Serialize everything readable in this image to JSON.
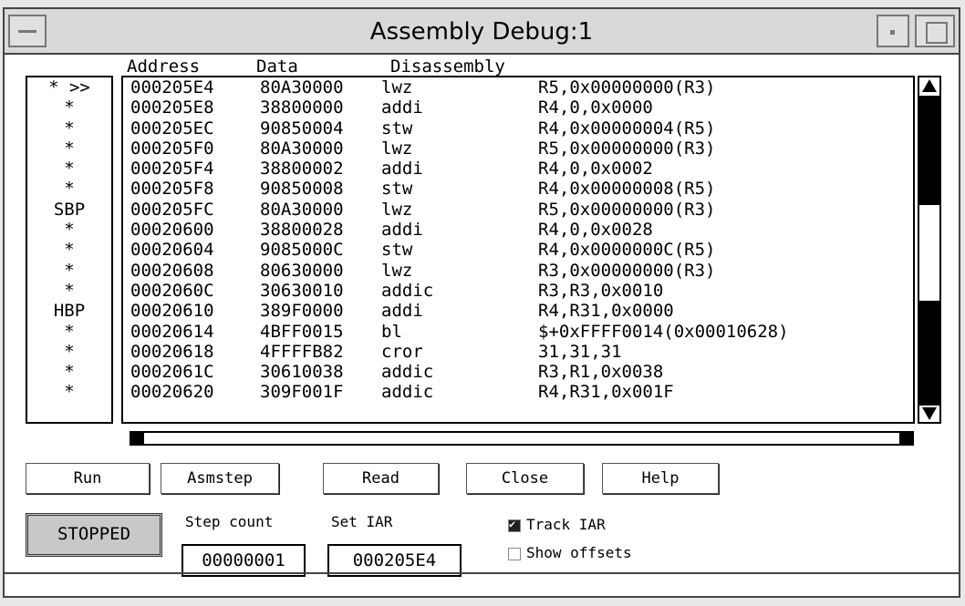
{
  "window": {
    "title": "Assembly Debug:1"
  },
  "headers": {
    "address": "Address",
    "data": "Data",
    "disassembly": "Disassembly"
  },
  "breakpoints": [
    "* >>",
    "*",
    "*",
    "*",
    "*",
    "*",
    "SBP",
    "*",
    "*",
    "*",
    "*",
    "HBP",
    "*",
    "*",
    "*",
    "*"
  ],
  "rows": [
    {
      "addr": "000205E4",
      "data": "80A30000",
      "mnemonic": "lwz",
      "operands": "R5,0x00000000(R3)"
    },
    {
      "addr": "000205E8",
      "data": "38800000",
      "mnemonic": "addi",
      "operands": "R4,0,0x0000"
    },
    {
      "addr": "000205EC",
      "data": "90850004",
      "mnemonic": "stw",
      "operands": "R4,0x00000004(R5)"
    },
    {
      "addr": "000205F0",
      "data": "80A30000",
      "mnemonic": "lwz",
      "operands": "R5,0x00000000(R3)"
    },
    {
      "addr": "000205F4",
      "data": "38800002",
      "mnemonic": "addi",
      "operands": "R4,0,0x0002"
    },
    {
      "addr": "000205F8",
      "data": "90850008",
      "mnemonic": "stw",
      "operands": "R4,0x00000008(R5)"
    },
    {
      "addr": "000205FC",
      "data": "80A30000",
      "mnemonic": "lwz",
      "operands": "R5,0x00000000(R3)"
    },
    {
      "addr": "00020600",
      "data": "38800028",
      "mnemonic": "addi",
      "operands": "R4,0,0x0028"
    },
    {
      "addr": "00020604",
      "data": "9085000C",
      "mnemonic": "stw",
      "operands": "R4,0x0000000C(R5)"
    },
    {
      "addr": "00020608",
      "data": "80630000",
      "mnemonic": "lwz",
      "operands": "R3,0x00000000(R3)"
    },
    {
      "addr": "0002060C",
      "data": "30630010",
      "mnemonic": "addic",
      "operands": "R3,R3,0x0010"
    },
    {
      "addr": "00020610",
      "data": "389F0000",
      "mnemonic": "addi",
      "operands": "R4,R31,0x0000"
    },
    {
      "addr": "00020614",
      "data": "4BFF0015",
      "mnemonic": "bl",
      "operands": "$+0xFFFF0014(0x00010628)"
    },
    {
      "addr": "00020618",
      "data": "4FFFFB82",
      "mnemonic": "cror",
      "operands": "31,31,31"
    },
    {
      "addr": "0002061C",
      "data": "30610038",
      "mnemonic": "addic",
      "operands": "R3,R1,0x0038"
    },
    {
      "addr": "00020620",
      "data": "309F001F",
      "mnemonic": "addic",
      "operands": "R4,R31,0x001F"
    }
  ],
  "buttons": {
    "run": "Run",
    "asmstep": "Asmstep",
    "read": "Read",
    "close": "Close",
    "help": "Help"
  },
  "status": "STOPPED",
  "step_count": {
    "label": "Step count",
    "value": "00000001"
  },
  "set_iar": {
    "label": "Set IAR",
    "value": "000205E4"
  },
  "track_iar": {
    "label": "Track IAR",
    "checked": true
  },
  "show_offsets": {
    "label": "Show offsets",
    "checked": false
  }
}
